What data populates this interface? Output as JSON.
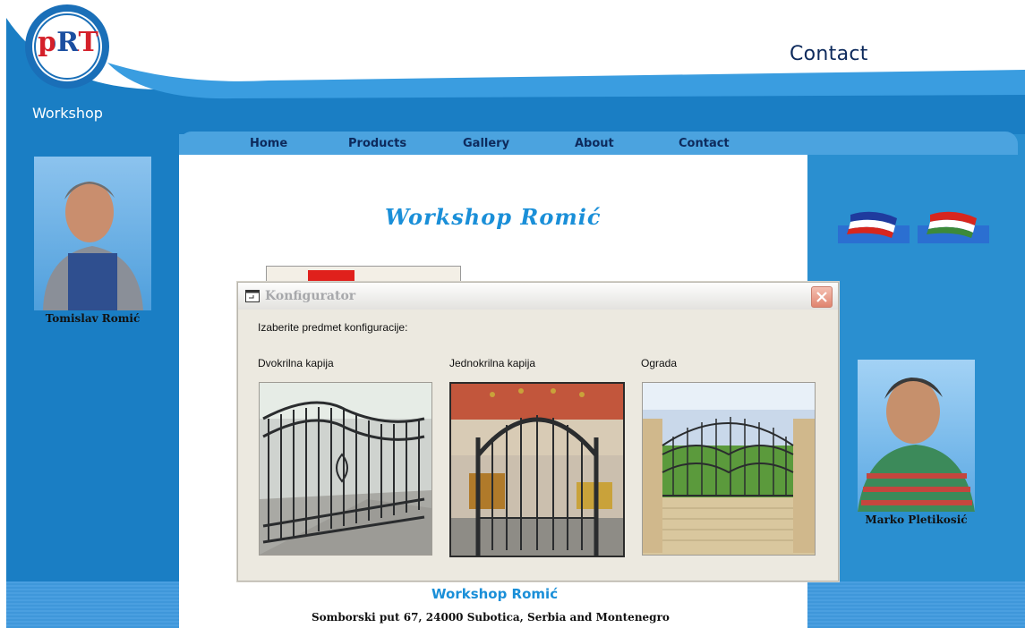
{
  "header": {
    "logo_text": "pRT",
    "page_heading": "Contact",
    "workshop_tag": "Workshop"
  },
  "nav": {
    "items": [
      {
        "label": "Home"
      },
      {
        "label": "Products"
      },
      {
        "label": "Gallery"
      },
      {
        "label": "About"
      },
      {
        "label": "Contact"
      }
    ]
  },
  "main": {
    "site_title": "Workshop Romić"
  },
  "people": {
    "left_name": "Tomislav Romić",
    "right_name": "Marko Pletikosić"
  },
  "languages": [
    {
      "icon": "flag-yugoslavia-icon"
    },
    {
      "icon": "flag-hungary-icon"
    }
  ],
  "dialog": {
    "title": "Konfigurator",
    "prompt": "Izaberite predmet konfiguracije:",
    "options": [
      {
        "label": "Dvokrilna kapija"
      },
      {
        "label": "Jednokrilna kapija",
        "selected": true
      },
      {
        "label": "Ograda"
      }
    ]
  },
  "footer": {
    "name": "Workshop Romić",
    "address": "Somborski put 67, 24000 Subotica, Serbia and Montenegro"
  },
  "colors": {
    "brand_blue": "#1a7ec4",
    "accent_blue": "#1a8fd8",
    "dark_navy": "#0d2a5c"
  }
}
